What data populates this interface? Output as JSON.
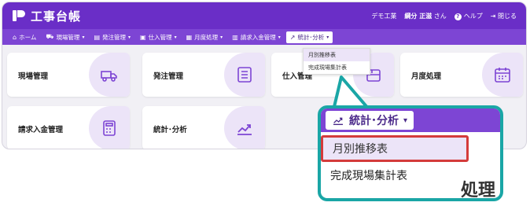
{
  "app": {
    "logo_text": "工事台帳"
  },
  "header": {
    "company": "デモ工業",
    "user_name": "綱分 正滋",
    "user_suffix": "さん",
    "help": "ヘルプ",
    "close": "閉じる"
  },
  "nav": [
    {
      "label": "ホーム",
      "icon": "home-icon"
    },
    {
      "label": "現場管理",
      "icon": "truck-icon"
    },
    {
      "label": "発注管理",
      "icon": "doc-icon"
    },
    {
      "label": "仕入管理",
      "icon": "box-icon"
    },
    {
      "label": "月度処理",
      "icon": "calendar-icon"
    },
    {
      "label": "請求入金管理",
      "icon": "calculator-icon"
    },
    {
      "label": "統計･分析",
      "icon": "chart-icon"
    }
  ],
  "dropdown": {
    "items": [
      "月別推移表",
      "完成現場集計表"
    ]
  },
  "tiles": [
    {
      "label": "現場管理",
      "icon": "truck-icon"
    },
    {
      "label": "発注管理",
      "icon": "list-icon"
    },
    {
      "label": "仕入管理",
      "icon": "box-icon"
    },
    {
      "label": "月度処理",
      "icon": "calendar-icon"
    },
    {
      "label": "請求入金管理",
      "icon": "calculator-icon"
    },
    {
      "label": "統計･分析",
      "icon": "chart-icon"
    }
  ],
  "zoom": {
    "button_label": "統計･分析",
    "bg_text": "処理"
  }
}
